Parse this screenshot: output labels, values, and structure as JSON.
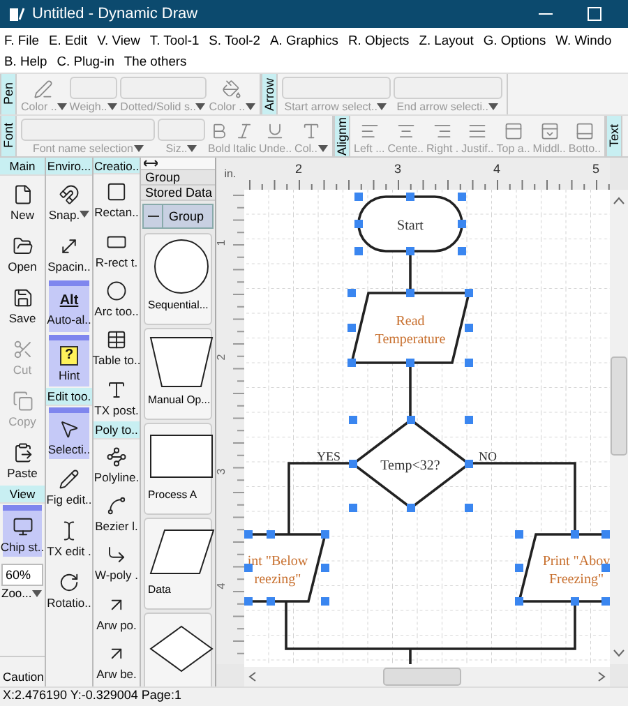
{
  "window": {
    "title": "Untitled - Dynamic Draw"
  },
  "menu": [
    [
      "F. File",
      "E. Edit",
      "V. View",
      "T. Tool-1",
      "S. Tool-2",
      "A. Graphics",
      "R. Objects",
      "Z. Layout",
      "G. Options",
      "W. Windo"
    ],
    [
      "B. Help",
      "C. Plug-in",
      "The others"
    ]
  ],
  "toolbar_rows": [
    {
      "groups": [
        {
          "label": "Pen",
          "items": [
            {
              "kind": "icon",
              "label": "Color ..",
              "dropdown": true,
              "disabled": true
            },
            {
              "kind": "field",
              "label": "Weigh..",
              "dropdown": true,
              "disabled": true
            },
            {
              "kind": "wide-field",
              "label": "Dotted/Solid s..",
              "dropdown": true,
              "disabled": true
            },
            {
              "kind": "icon",
              "label": "Color ..",
              "dropdown": true,
              "disabled": true
            }
          ]
        },
        {
          "label": "Arrow",
          "items": [
            {
              "kind": "long-field",
              "label": "Start arrow select..",
              "dropdown": true,
              "disabled": true
            },
            {
              "kind": "long-field",
              "label": "End arrow selecti..",
              "dropdown": true,
              "disabled": true
            }
          ]
        }
      ]
    },
    {
      "groups": [
        {
          "label": "Font",
          "items": [
            {
              "kind": "name-field",
              "label": "Font name selection",
              "dropdown": true,
              "disabled": true
            },
            {
              "kind": "field",
              "label": "Siz..",
              "dropdown": true,
              "disabled": true
            },
            {
              "kind": "icon",
              "label": "Bold",
              "dropdown": false,
              "disabled": true
            },
            {
              "kind": "icon",
              "label": "Italic",
              "dropdown": false,
              "disabled": true
            },
            {
              "kind": "icon",
              "label": "Unde..",
              "dropdown": false,
              "disabled": true
            },
            {
              "kind": "icon",
              "label": "Col..",
              "dropdown": true,
              "disabled": true
            }
          ]
        },
        {
          "label": "Alignm",
          "items": [
            {
              "kind": "icon",
              "label": "Left ...",
              "dropdown": false,
              "disabled": true
            },
            {
              "kind": "icon",
              "label": "Cente..",
              "dropdown": false,
              "disabled": true
            },
            {
              "kind": "icon",
              "label": "Right .",
              "dropdown": false,
              "disabled": true
            },
            {
              "kind": "icon",
              "label": "Justif..",
              "dropdown": false,
              "disabled": true
            },
            {
              "kind": "icon",
              "label": "Top a..",
              "dropdown": false,
              "disabled": true
            },
            {
              "kind": "icon",
              "label": "Middl..",
              "dropdown": false,
              "disabled": true
            },
            {
              "kind": "icon",
              "label": "Botto..",
              "dropdown": false,
              "disabled": true
            }
          ]
        },
        {
          "label": "Text"
        }
      ]
    }
  ],
  "columns": [
    {
      "sections": [
        {
          "title": "Main",
          "items": [
            {
              "label": "New",
              "disabled": false,
              "on": false
            },
            {
              "label": "Open",
              "disabled": false,
              "on": false
            },
            {
              "label": "Save",
              "disabled": false,
              "on": false
            },
            {
              "label": "Cut",
              "disabled": true,
              "on": false
            },
            {
              "label": "Copy",
              "disabled": true,
              "on": false
            },
            {
              "label": "Paste",
              "disabled": false,
              "on": false
            }
          ]
        },
        {
          "title": "View",
          "items": [
            {
              "label": "Chip st..",
              "disabled": false,
              "on": true
            }
          ]
        }
      ],
      "zoom": {
        "value": "60%",
        "label": "Zoo..."
      },
      "footer": "Caution"
    },
    {
      "sections": [
        {
          "title": "Enviro...",
          "items": [
            {
              "label": "Snap.",
              "disabled": false,
              "on": false,
              "dropdown": true
            },
            {
              "label": "Spacin..",
              "disabled": false,
              "on": false
            },
            {
              "label": "Auto-al..",
              "disabled": false,
              "on": true,
              "badge": "Alt"
            },
            {
              "label": "Hint",
              "disabled": false,
              "on": true,
              "badge": "?"
            }
          ]
        },
        {
          "title": "Edit too.",
          "items": [
            {
              "label": "Selecti..",
              "disabled": false,
              "on": true
            },
            {
              "label": "Fig edit..",
              "disabled": false,
              "on": false
            },
            {
              "label": "TX edit .",
              "disabled": false,
              "on": false
            },
            {
              "label": "Rotatio..",
              "disabled": false,
              "on": false
            }
          ]
        }
      ]
    },
    {
      "sections": [
        {
          "title": "Creatio..",
          "items": [
            {
              "label": "Rectan..",
              "disabled": false,
              "on": false
            },
            {
              "label": "R-rect t.",
              "disabled": false,
              "on": false
            },
            {
              "label": "Arc too..",
              "disabled": false,
              "on": false
            },
            {
              "label": "Table to..",
              "disabled": false,
              "on": false
            },
            {
              "label": "TX post.",
              "disabled": false,
              "on": false
            }
          ]
        },
        {
          "title": "Poly to..",
          "items": [
            {
              "label": "Polyline.",
              "disabled": false,
              "on": false
            },
            {
              "label": "Bezier l.",
              "disabled": false,
              "on": false
            },
            {
              "label": "W-poly .",
              "disabled": false,
              "on": false
            },
            {
              "label": "Arw po.",
              "disabled": false,
              "on": false
            },
            {
              "label": "Arw be.",
              "disabled": false,
              "on": false
            }
          ]
        }
      ]
    }
  ],
  "stored_panel": {
    "category": "Group",
    "title": "Stored Data",
    "group": {
      "label": "Group",
      "expanded": true
    },
    "shapes": [
      {
        "kind": "circle",
        "label": "Sequential..."
      },
      {
        "kind": "trapezoid",
        "label": "Manual Op..."
      },
      {
        "kind": "rectangle",
        "label": "Process A"
      },
      {
        "kind": "parallelogram",
        "label": "Data"
      },
      {
        "kind": "diamond"
      }
    ]
  },
  "ruler": {
    "unit": "in.",
    "top_labels": [
      "2",
      "3",
      "4",
      "5"
    ],
    "left_labels": [
      "1",
      "2",
      "3",
      "4"
    ]
  },
  "flowchart": {
    "nodes": [
      {
        "kind": "terminal",
        "lines": [
          "Start"
        ],
        "selected": true
      },
      {
        "kind": "data",
        "lines": [
          "Read",
          "Temperature"
        ],
        "selected": true
      },
      {
        "kind": "decision",
        "lines": [
          "Temp<32?"
        ],
        "selected": true
      },
      {
        "kind": "data",
        "lines": [
          "int \"Below",
          "reezing\""
        ],
        "selected": true
      },
      {
        "kind": "data",
        "lines": [
          "Print \"Abov",
          "Freezing\""
        ],
        "selected": true
      }
    ],
    "edge_labels": [
      "YES",
      "NO"
    ]
  },
  "status_bar": "X:2.476190 Y:-0.329004 Page:1"
}
